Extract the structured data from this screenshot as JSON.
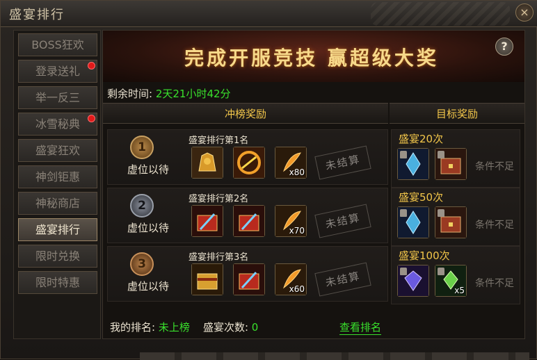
{
  "window": {
    "title": "盛宴排行",
    "close_icon": "close-icon"
  },
  "sidebar": {
    "items": [
      {
        "label": "BOSS狂欢",
        "dot": false,
        "active": false
      },
      {
        "label": "登录送礼",
        "dot": true,
        "active": false
      },
      {
        "label": "举一反三",
        "dot": false,
        "active": false
      },
      {
        "label": "冰雪秘典",
        "dot": true,
        "active": false
      },
      {
        "label": "盛宴狂欢",
        "dot": false,
        "active": false
      },
      {
        "label": "神剑钜惠",
        "dot": false,
        "active": false
      },
      {
        "label": "神秘商店",
        "dot": false,
        "active": false
      },
      {
        "label": "盛宴排行",
        "dot": false,
        "active": true
      },
      {
        "label": "限时兑换",
        "dot": false,
        "active": false
      },
      {
        "label": "限时特惠",
        "dot": false,
        "active": false
      }
    ]
  },
  "banner": {
    "text": "完成开服竞技  赢超级大奖",
    "help_label": "?"
  },
  "remaining": {
    "label": "剩余时间:",
    "value": "2天21小时42分"
  },
  "headers": {
    "rank_rewards": "冲榜奖励",
    "target_rewards": "目标奖励"
  },
  "ranks": [
    {
      "number": "1",
      "name": "虚位以待",
      "title": "盛宴排行第1名",
      "status": "未结算",
      "items": [
        {
          "icon": "golden-armor-icon",
          "qty": ""
        },
        {
          "icon": "fire-wheel-icon",
          "qty": ""
        },
        {
          "icon": "feather-icon",
          "qty": "x80"
        }
      ]
    },
    {
      "number": "2",
      "name": "虚位以待",
      "title": "盛宴排行第2名",
      "status": "未结算",
      "items": [
        {
          "icon": "red-chest-icon",
          "qty": ""
        },
        {
          "icon": "red-chest-icon",
          "qty": ""
        },
        {
          "icon": "feather-icon",
          "qty": "x70"
        }
      ]
    },
    {
      "number": "3",
      "name": "虚位以待",
      "title": "盛宴排行第3名",
      "status": "未结算",
      "items": [
        {
          "icon": "gold-chest-icon",
          "qty": ""
        },
        {
          "icon": "red-chest-icon",
          "qty": ""
        },
        {
          "icon": "feather-icon",
          "qty": "x60"
        }
      ]
    }
  ],
  "targets": [
    {
      "label": "盛宴20次",
      "status": "条件不足",
      "items": [
        {
          "icon": "blue-crystal-icon",
          "qty": ""
        },
        {
          "icon": "treasure-chest-icon",
          "qty": ""
        }
      ]
    },
    {
      "label": "盛宴50次",
      "status": "条件不足",
      "items": [
        {
          "icon": "blue-crystal-icon",
          "qty": ""
        },
        {
          "icon": "treasure-chest-icon",
          "qty": ""
        }
      ]
    },
    {
      "label": "盛宴100次",
      "status": "条件不足",
      "items": [
        {
          "icon": "purple-gem-icon",
          "qty": ""
        },
        {
          "icon": "green-gem-icon",
          "qty": "x5"
        }
      ]
    }
  ],
  "footer": {
    "my_rank_label": "我的排名:",
    "my_rank_value": "未上榜",
    "count_label": "盛宴次数:",
    "count_value": "0",
    "view_rank": "查看排名"
  }
}
